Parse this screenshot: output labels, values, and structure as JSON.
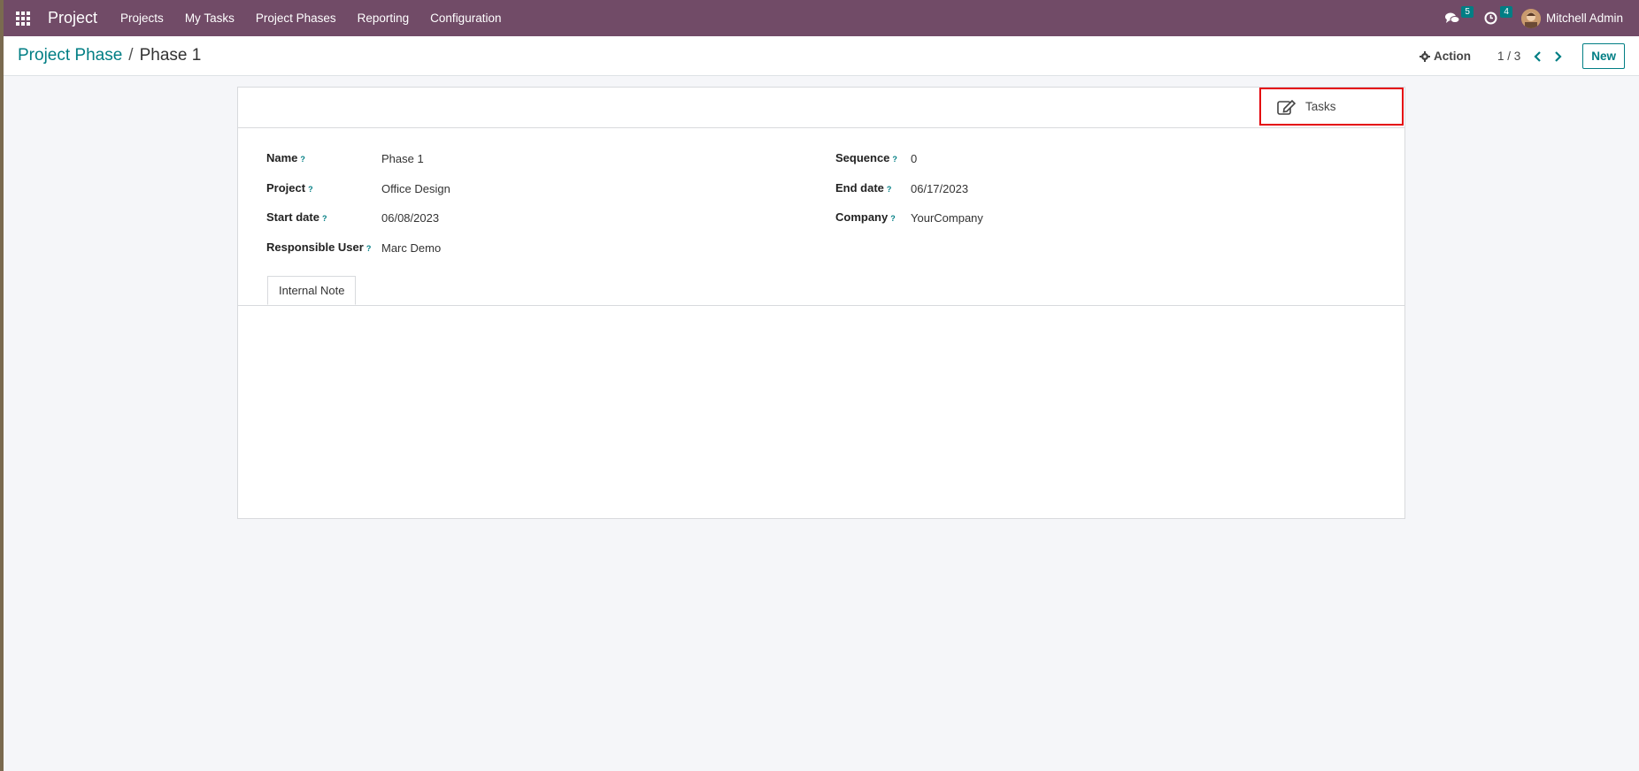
{
  "topbar": {
    "app_name": "Project",
    "menu": [
      "Projects",
      "My Tasks",
      "Project Phases",
      "Reporting",
      "Configuration"
    ],
    "messages_count": "5",
    "activities_count": "4",
    "user_name": "Mitchell Admin",
    "icons": [
      "apps-grid-icon",
      "chat-icon",
      "clock-icon",
      "user-avatar"
    ]
  },
  "control_panel": {
    "breadcrumb_parent": "Project Phase",
    "breadcrumb_separator": "/",
    "breadcrumb_current": "Phase 1",
    "action_label": "Action",
    "pager": "1 / 3",
    "new_label": "New"
  },
  "form": {
    "button_box": {
      "tasks_label": "Tasks"
    },
    "help_mark": "?",
    "left": [
      {
        "label": "Name",
        "value": "Phase 1"
      },
      {
        "label": "Project",
        "value": "Office Design"
      },
      {
        "label": "Start date",
        "value": "06/08/2023"
      },
      {
        "label": "Responsible User",
        "value": "Marc Demo"
      }
    ],
    "right": [
      {
        "label": "Sequence",
        "value": "0"
      },
      {
        "label": "End date",
        "value": "06/17/2023"
      },
      {
        "label": "Company",
        "value": "YourCompany"
      }
    ],
    "tabs": [
      "Internal Note"
    ]
  },
  "colors": {
    "topbar": "#714b67",
    "accent": "#017e84",
    "highlight_border": "#e4060e"
  }
}
